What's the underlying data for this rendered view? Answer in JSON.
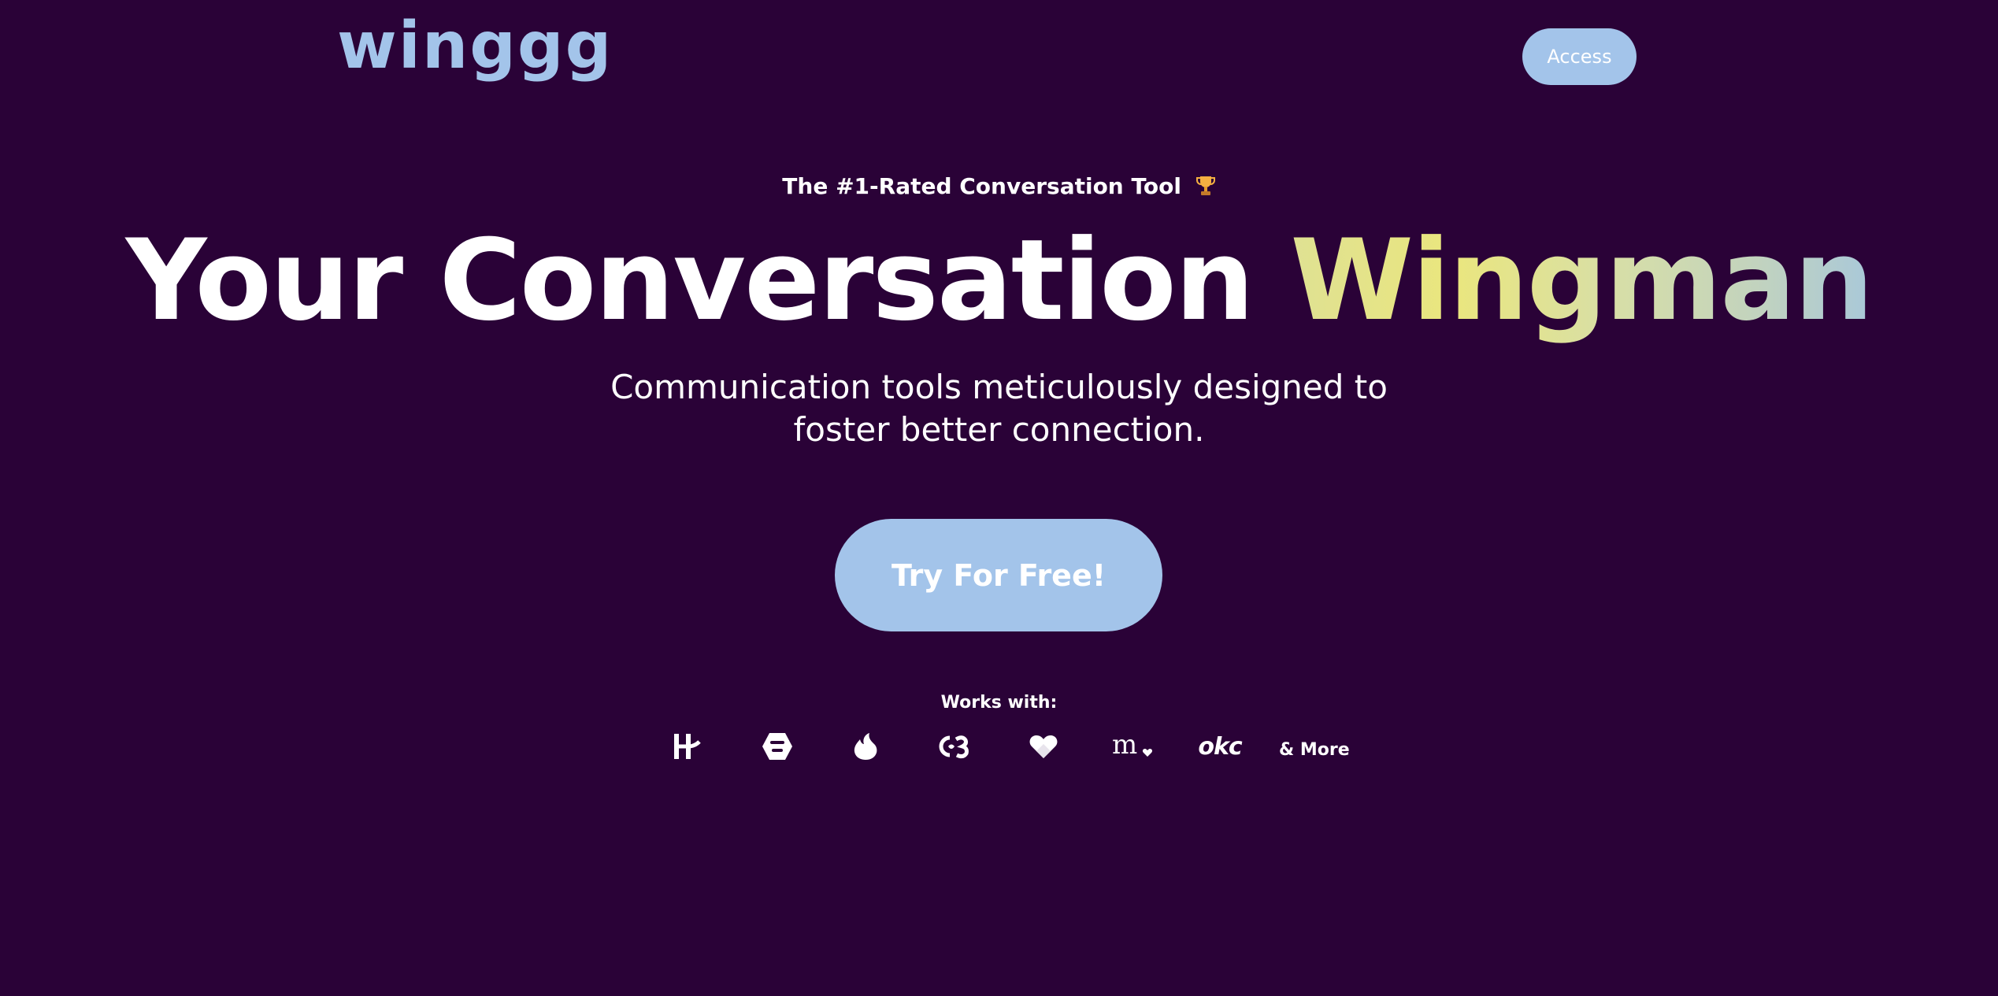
{
  "header": {
    "logo_text": "winggg",
    "access_button": "Access"
  },
  "hero": {
    "eyebrow": "The #1-Rated Conversation Tool",
    "eyebrow_icon": "trophy-icon",
    "headline_main": "Your Conversation ",
    "headline_accent": "Wingman",
    "subtitle_line1": "Communication tools meticulously designed to",
    "subtitle_line2": "foster better connection.",
    "cta_label": "Try For Free!"
  },
  "works_with": {
    "label": "Works with:",
    "apps": [
      {
        "name": "Hinge",
        "icon": "hinge-icon"
      },
      {
        "name": "Bumble",
        "icon": "bumble-icon"
      },
      {
        "name": "Tinder",
        "icon": "tinder-icon"
      },
      {
        "name": "Coffee Meets Bagel",
        "icon": "cmb-icon"
      },
      {
        "name": "Happn",
        "icon": "heart-icon"
      },
      {
        "name": "Match",
        "icon": "match-icon"
      },
      {
        "name": "OkCupid",
        "icon": "okc-icon",
        "text": "okc"
      }
    ],
    "more_label": "& More"
  },
  "colors": {
    "background": "#2a0237",
    "accent_blue": "#a3c4ea",
    "text": "#ffffff",
    "gradient_start": "#dfe193",
    "gradient_end": "#a9c8d9"
  }
}
